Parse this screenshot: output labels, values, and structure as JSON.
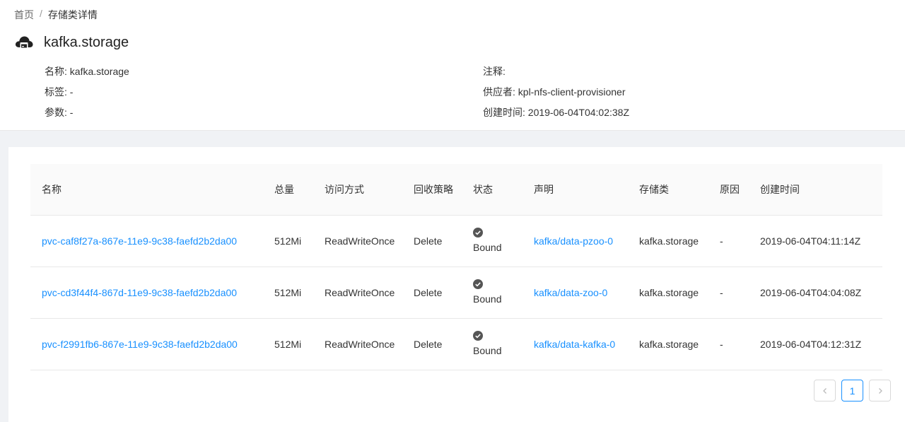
{
  "breadcrumb": {
    "home": "首页",
    "sep": "/",
    "current": "存储类详情"
  },
  "header": {
    "title": "kafka.storage",
    "icon": "cloud-storage-icon"
  },
  "meta": {
    "name_label": "名称:",
    "name_value": "kafka.storage",
    "tags_label": "标签:",
    "tags_value": "-",
    "params_label": "参数:",
    "params_value": "-",
    "notes_label": "注释:",
    "notes_value": "",
    "provider_label": "供应者:",
    "provider_value": "kpl-nfs-client-provisioner",
    "created_label": "创建时间:",
    "created_value": "2019-06-04T04:02:38Z"
  },
  "table": {
    "headers": [
      "名称",
      "总量",
      "访问方式",
      "回收策略",
      "状态",
      "声明",
      "存储类",
      "原因",
      "创建时间"
    ],
    "rows": [
      {
        "name": "pvc-caf8f27a-867e-11e9-9c38-faefd2b2da00",
        "capacity": "512Mi",
        "access": "ReadWriteOnce",
        "reclaim": "Delete",
        "status": "Bound",
        "claim": "kafka/data-pzoo-0",
        "storage_class": "kafka.storage",
        "reason": "-",
        "created": "2019-06-04T04:11:14Z"
      },
      {
        "name": "pvc-cd3f44f4-867d-11e9-9c38-faefd2b2da00",
        "capacity": "512Mi",
        "access": "ReadWriteOnce",
        "reclaim": "Delete",
        "status": "Bound",
        "claim": "kafka/data-zoo-0",
        "storage_class": "kafka.storage",
        "reason": "-",
        "created": "2019-06-04T04:04:08Z"
      },
      {
        "name": "pvc-f2991fb6-867e-11e9-9c38-faefd2b2da00",
        "capacity": "512Mi",
        "access": "ReadWriteOnce",
        "reclaim": "Delete",
        "status": "Bound",
        "claim": "kafka/data-kafka-0",
        "storage_class": "kafka.storage",
        "reason": "-",
        "created": "2019-06-04T04:12:31Z"
      }
    ]
  },
  "pagination": {
    "current": "1",
    "prev_icon": "chevron-left-icon",
    "next_icon": "chevron-right-icon"
  },
  "colors": {
    "link": "#1890ff",
    "border": "#e8e8e8",
    "bg": "#f0f2f5"
  }
}
